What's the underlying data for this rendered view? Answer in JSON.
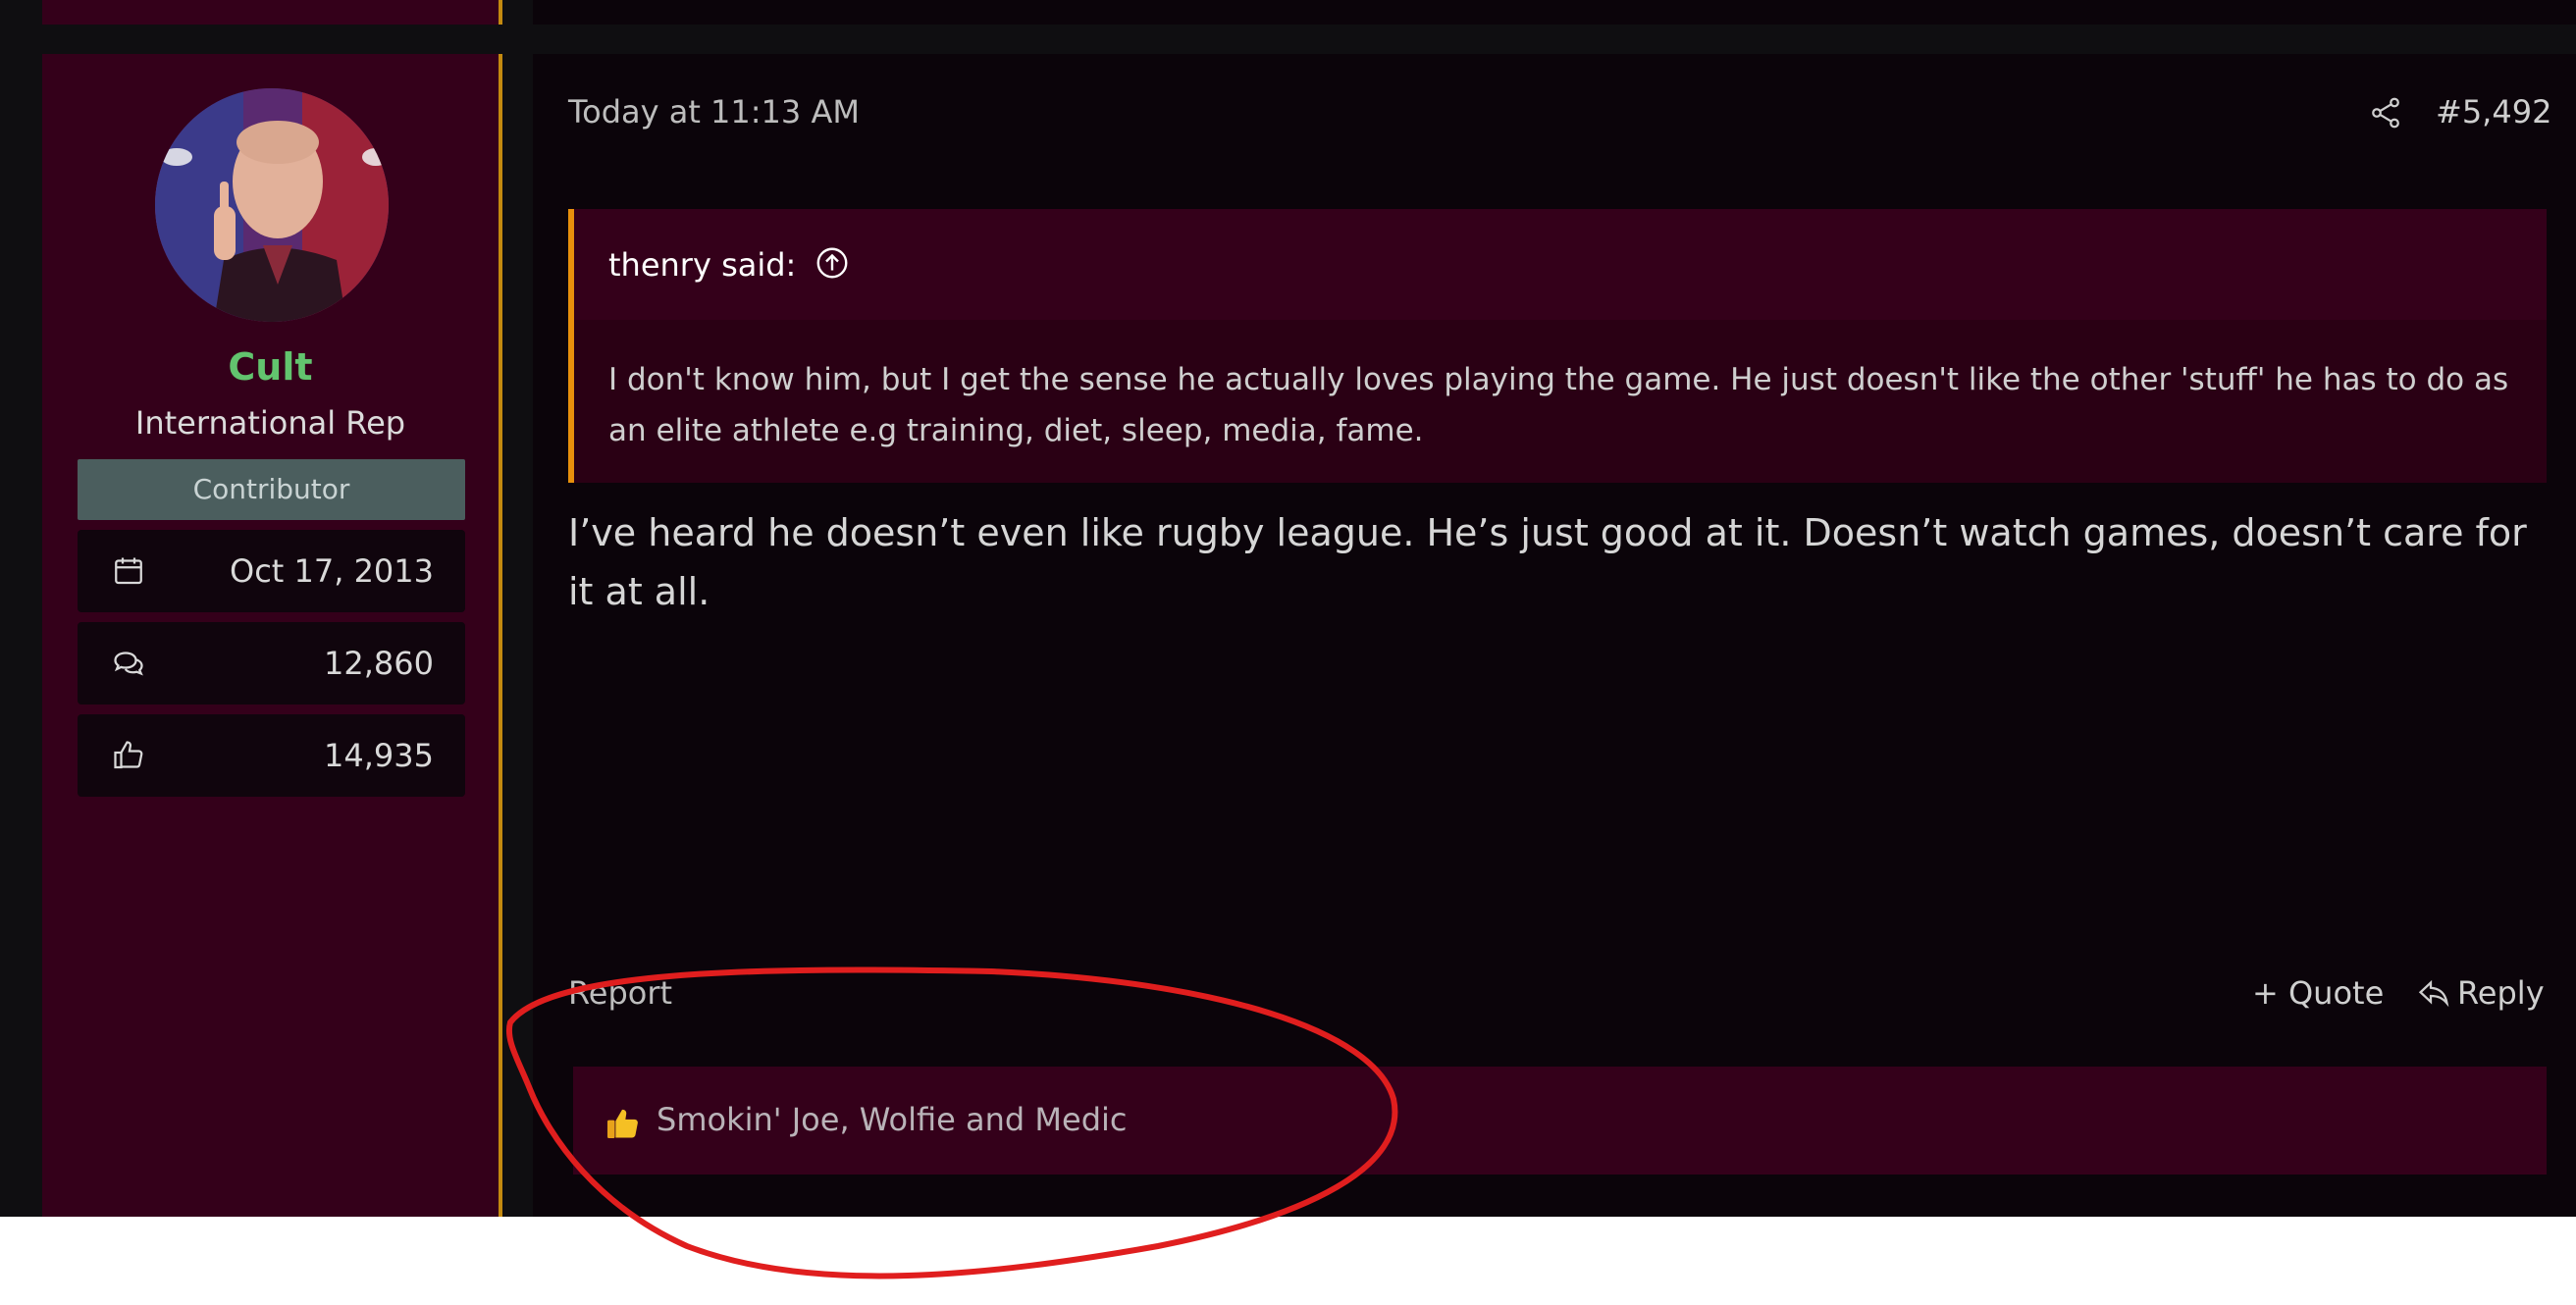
{
  "user": {
    "name": "Cult",
    "title": "International Rep",
    "banner": "Contributor",
    "stats": [
      {
        "icon": "calendar-icon",
        "value": "Oct 17, 2013"
      },
      {
        "icon": "messages-icon",
        "value": "12,860"
      },
      {
        "icon": "thumbs-up-icon",
        "value": "14,935"
      }
    ]
  },
  "post": {
    "date": "Today at 11:13 AM",
    "number": "#5,492",
    "quote": {
      "author": "thenry said:",
      "text": "I don't know him, but I get the sense he actually loves playing the game. He just doesn't like the other 'stuff' he has to do as an elite athlete e.g training, diet, sleep, media, fame."
    },
    "body": "I’ve heard he doesn’t even like rugby league. He’s just good at it. Doesn’t watch games, doesn’t care for it at all.",
    "actions": {
      "report": "Report",
      "quote": "+ Quote",
      "reply": "Reply"
    },
    "reactions": {
      "emoji": "thumbs-up-emoji",
      "text": "Smokin' Joe, Wolfie and Medic"
    }
  },
  "colors": {
    "user_panel": "#34001a",
    "accent_gold": "#c48a10",
    "quote_border": "#e8900c",
    "username": "#62c46e",
    "annotation_circle": "#e01e1e"
  }
}
